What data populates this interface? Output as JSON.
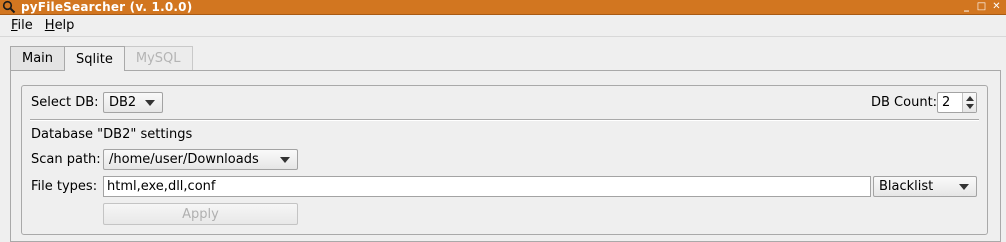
{
  "window": {
    "title": "pyFileSearcher (v. 1.0.0)",
    "controls": [
      "_",
      "□",
      "✕"
    ]
  },
  "menu": {
    "file": {
      "label": "File",
      "mnemonic": "F",
      "rest": "ile"
    },
    "help": {
      "label": "Help",
      "mnemonic": "H",
      "rest": "elp"
    }
  },
  "tabs": [
    {
      "label": "Main",
      "state": "normal"
    },
    {
      "label": "Sqlite",
      "state": "active"
    },
    {
      "label": "MySQL",
      "state": "disabled"
    }
  ],
  "sqlite": {
    "select_db_label": "Select DB:",
    "select_db_value": "DB2",
    "db_count_label": "DB Count:",
    "db_count_value": "2",
    "settings_heading": "Database \"DB2\" settings",
    "scan_path_label": "Scan path:",
    "scan_path_value": "/home/user/Downloads",
    "file_types_label": "File types:",
    "file_types_value": "html,exe,dll,conf",
    "filter_mode_value": "Blacklist",
    "apply_label": "Apply"
  },
  "colors": {
    "titlebar": "#d27620",
    "background": "#efefef"
  }
}
